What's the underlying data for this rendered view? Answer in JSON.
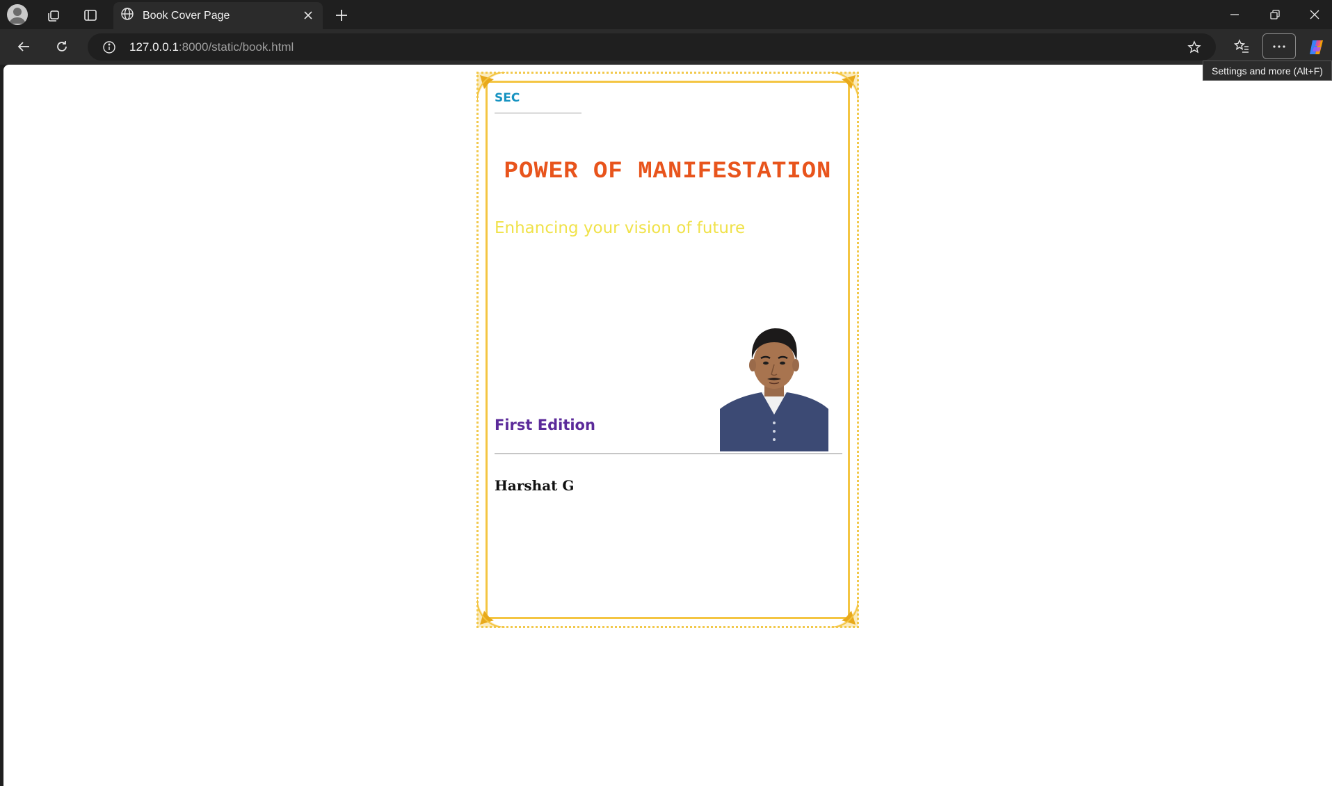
{
  "browser": {
    "tab_title": "Book Cover Page",
    "url_host": "127.0.0.1",
    "url_path": ":8000/static/book.html",
    "tooltip": "Settings and more (Alt+F)"
  },
  "cover": {
    "publisher": "SEC",
    "title": "POWER OF MANIFESTATION",
    "subtitle": "Enhancing your vision of future",
    "edition": "First Edition",
    "author": "Harshat G"
  }
}
